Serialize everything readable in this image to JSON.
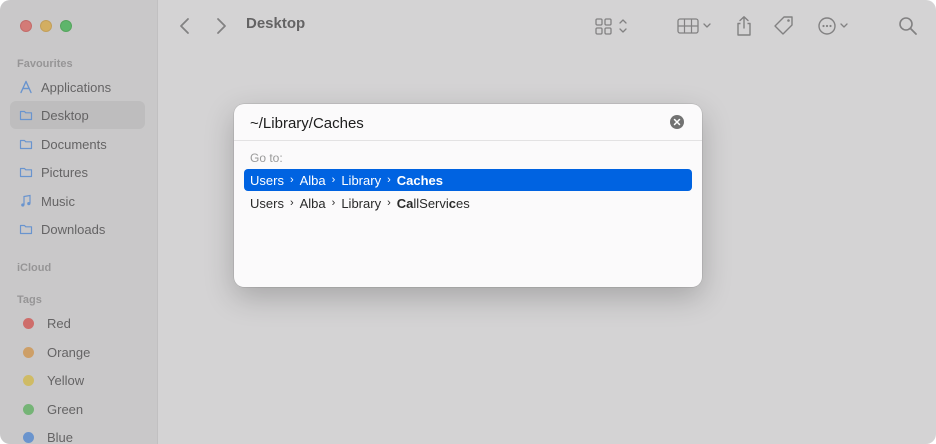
{
  "window": {
    "title": "Desktop"
  },
  "sidebar": {
    "sections": [
      {
        "header": "Favourites",
        "items": [
          {
            "label": "Applications",
            "icon": "applications-icon"
          },
          {
            "label": "Desktop",
            "icon": "folder-icon",
            "selected": true
          },
          {
            "label": "Documents",
            "icon": "folder-icon"
          },
          {
            "label": "Pictures",
            "icon": "folder-icon"
          },
          {
            "label": "Music",
            "icon": "music-note-icon"
          },
          {
            "label": "Downloads",
            "icon": "folder-icon"
          }
        ]
      },
      {
        "header": "iCloud",
        "items": []
      },
      {
        "header": "Tags",
        "items": [
          {
            "label": "Red",
            "color": "#f5453f"
          },
          {
            "label": "Orange",
            "color": "#f3a13a"
          },
          {
            "label": "Yellow",
            "color": "#f6d336"
          },
          {
            "label": "Green",
            "color": "#52c655"
          },
          {
            "label": "Blue",
            "color": "#3f8df3"
          }
        ]
      }
    ]
  },
  "toolbar": {
    "icons": [
      "back-icon",
      "forward-icon",
      "icon-view-icon",
      "group-icon",
      "share-icon",
      "tag-icon",
      "more-icon",
      "search-icon"
    ]
  },
  "goto_sheet": {
    "path_value": "~/Library/Caches",
    "label": "Go to:",
    "results": [
      {
        "crumbs": [
          "Users",
          "Alba",
          "Library"
        ],
        "match_bold": "Caches",
        "selected": true
      },
      {
        "crumbs": [
          "Users",
          "Alba",
          "Library"
        ],
        "match_parts": [
          {
            "text": "Ca",
            "bold": true
          },
          {
            "text": "llServi",
            "bold": false
          },
          {
            "text": "c",
            "bold": true
          },
          {
            "text": "es",
            "bold": false
          }
        ],
        "selected": false
      }
    ]
  },
  "colors": {
    "selection": "#0063e1",
    "overlay": "rgba(160,157,160,0.45)"
  }
}
